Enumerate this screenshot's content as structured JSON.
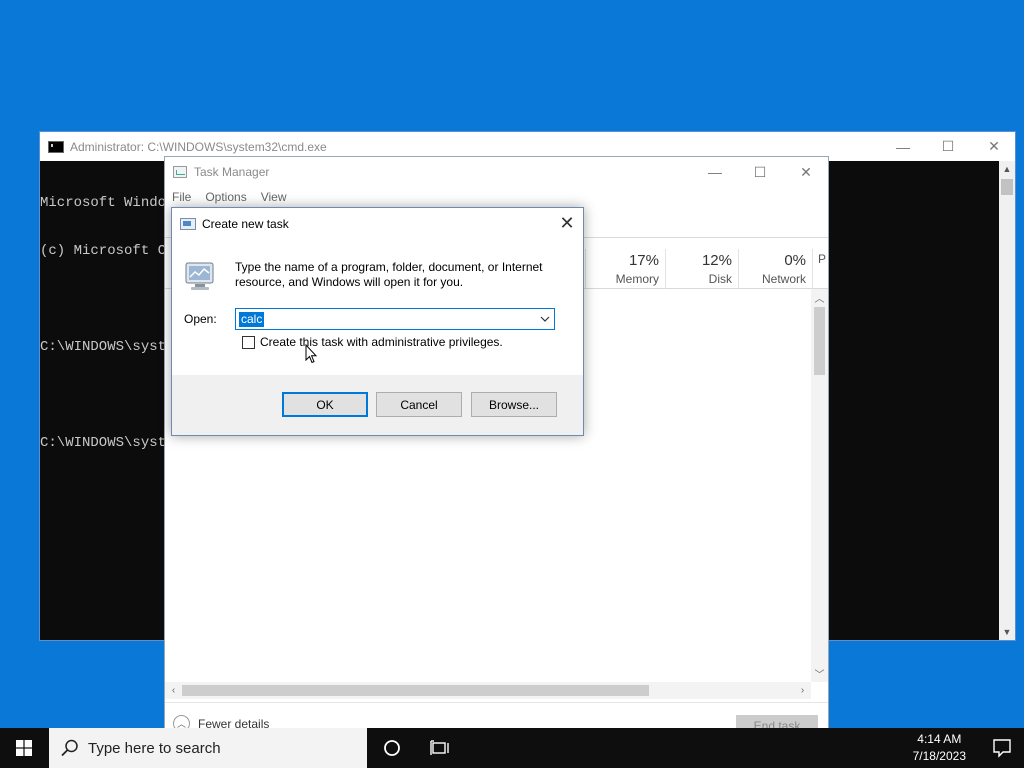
{
  "cmd": {
    "title": "Administrator: C:\\WINDOWS\\system32\\cmd.exe",
    "lines": [
      "Microsoft Window",
      "(c) Microsoft Co",
      "",
      "C:\\WINDOWS\\syste",
      "",
      "C:\\WINDOWS\\syste"
    ]
  },
  "window_controls": {
    "minimize": "—",
    "maximize": "☐",
    "close": "✕"
  },
  "task_manager": {
    "title": "Task Manager",
    "menu": [
      "File",
      "Options",
      "View"
    ],
    "columns": [
      {
        "pct": "17%",
        "label": "Memory"
      },
      {
        "pct": "12%",
        "label": "Disk"
      },
      {
        "pct": "0%",
        "label": "Network"
      },
      {
        "pct": "",
        "label": "P"
      }
    ],
    "fewer_details": "Fewer details",
    "end_task": "End task"
  },
  "run_dialog": {
    "title": "Create new task",
    "description": "Type the name of a program, folder, document, or Internet resource, and Windows will open it for you.",
    "open_label": "Open:",
    "open_value": "calc",
    "admin_checkbox_label": "Create this task with administrative privileges.",
    "admin_checked": false,
    "ok_label": "OK",
    "cancel_label": "Cancel",
    "browse_label": "Browse..."
  },
  "taskbar": {
    "search_placeholder": "Type here to search",
    "time": "4:14 AM",
    "date": "7/18/2023"
  },
  "colors": {
    "desktop": "#0a78d7",
    "accent": "#0078d7",
    "taskbar": "#0e0e0e"
  }
}
